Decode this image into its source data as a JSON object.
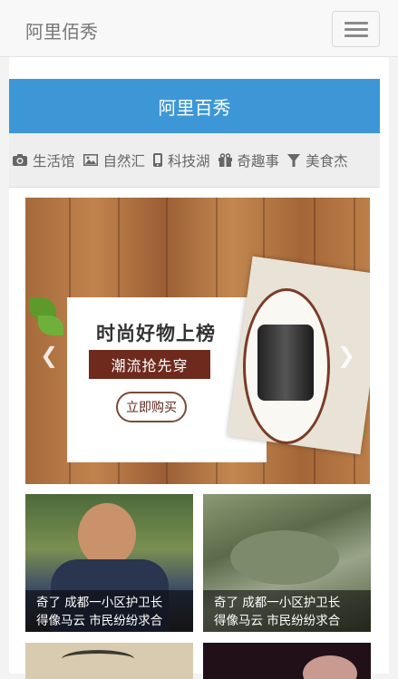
{
  "navbar": {
    "brand": "阿里佰秀",
    "menu_icon": "hamburger-icon"
  },
  "banner": {
    "title": "阿里百秀"
  },
  "categories": [
    {
      "icon": "camera-icon",
      "label": "生活馆"
    },
    {
      "icon": "picture-icon",
      "label": "自然汇"
    },
    {
      "icon": "phone-icon",
      "label": "科技湖"
    },
    {
      "icon": "gift-icon",
      "label": "奇趣事"
    },
    {
      "icon": "filter-icon",
      "label": "美食杰"
    }
  ],
  "carousel": {
    "headline": "时尚好物上榜",
    "ribbon": "潮流抢先穿",
    "button": "立即购买",
    "prev_icon": "chevron-left-icon",
    "next_icon": "chevron-right-icon"
  },
  "news": [
    {
      "line1": "奇了 成都一小区护卫长",
      "line2": "得像马云 市民纷纷求合"
    },
    {
      "line1": "奇了 成都一小区护卫长",
      "line2": "得像马云 市民纷纷求合"
    }
  ],
  "colors": {
    "banner": "#3d97d6",
    "ribbon": "#6f2a1e"
  }
}
